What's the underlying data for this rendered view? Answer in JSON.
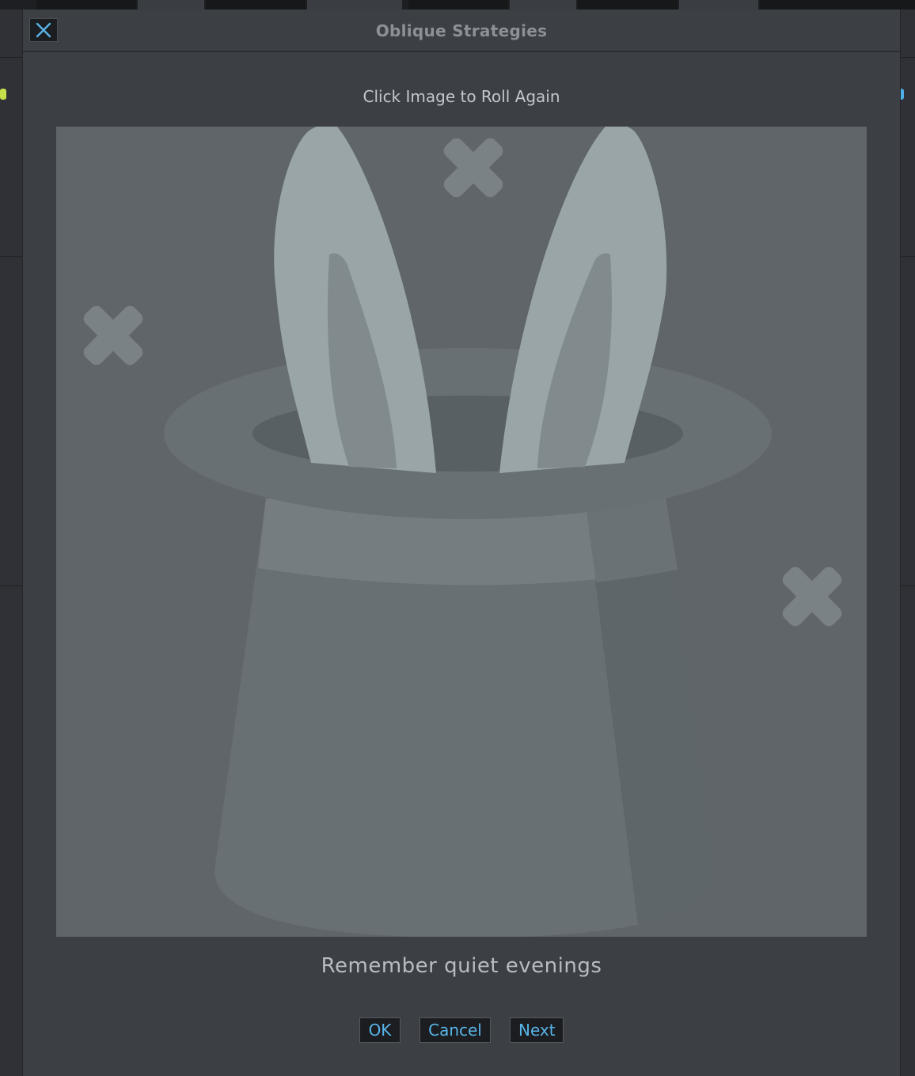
{
  "dialog": {
    "title": "Oblique Strategies",
    "close_icon": "close-icon",
    "hint": "Click Image to Roll Again",
    "image_icon": "magic-hat-rabbit-icon",
    "strategy": "Remember quiet evenings",
    "buttons": {
      "ok": "OK",
      "cancel": "Cancel",
      "next": "Next"
    }
  },
  "colors": {
    "dialog_bg": "#3c3f44",
    "image_bg": "#5f6569",
    "button_text": "#58b4e8",
    "accent_green": "#c6e04a",
    "accent_blue": "#4fb0e8"
  }
}
